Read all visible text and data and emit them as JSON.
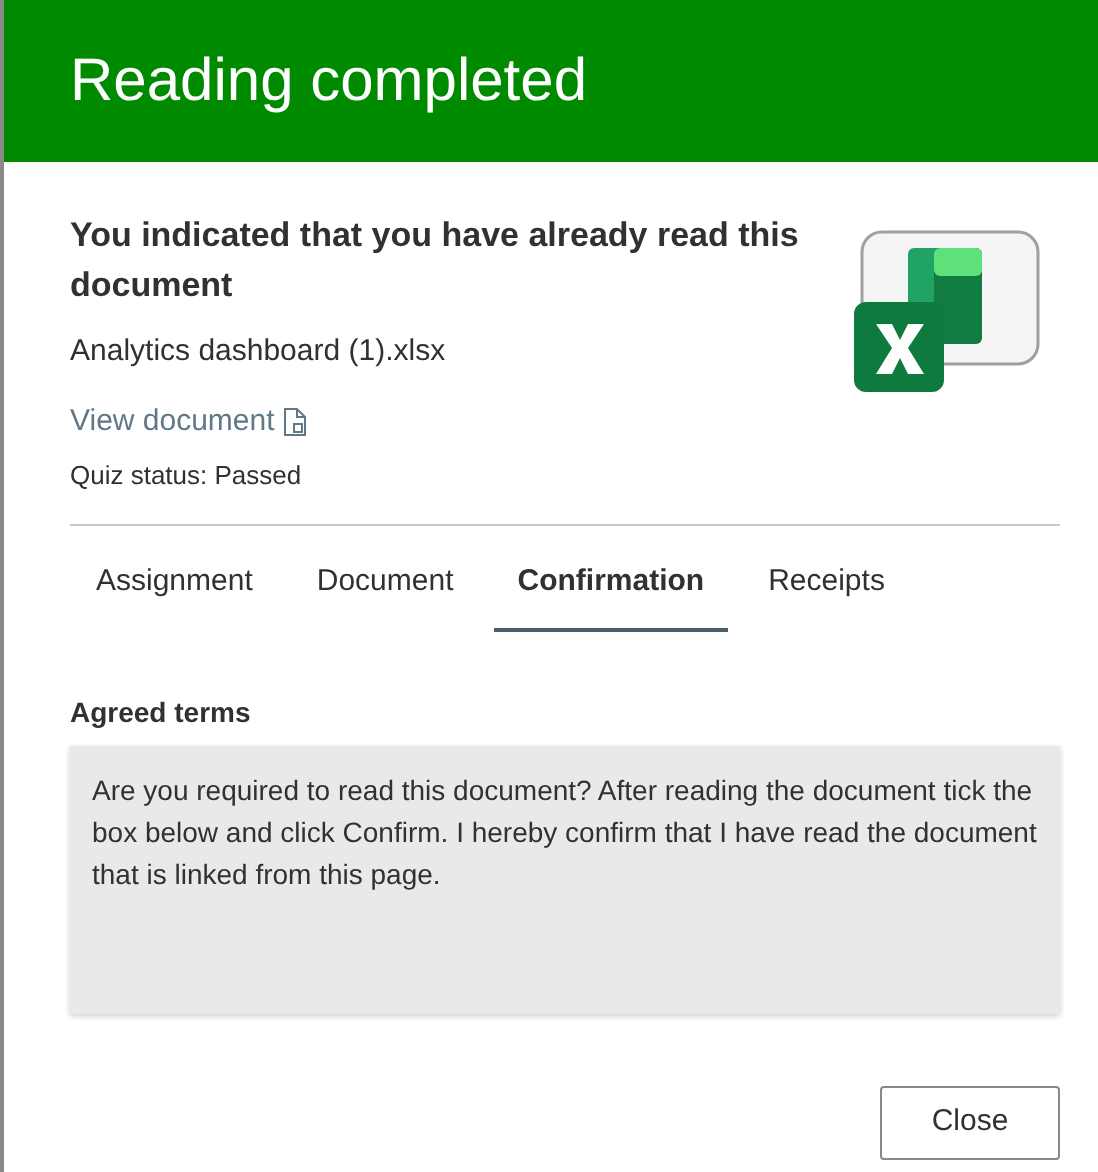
{
  "header": {
    "title": "Reading completed"
  },
  "document": {
    "heading": "You indicated that you have already read this document",
    "file_name": "Analytics dashboard (1).xlsx",
    "view_link": "View document",
    "quiz_status": "Quiz status: Passed"
  },
  "tabs": [
    {
      "label": "Assignment",
      "selected": false
    },
    {
      "label": "Document",
      "selected": false
    },
    {
      "label": "Confirmation",
      "selected": true
    },
    {
      "label": "Receipts",
      "selected": false
    }
  ],
  "agreed_terms": {
    "label": "Agreed terms",
    "text": "Are you required to read this document? After reading the document tick the box below and click Confirm. I hereby confirm that I have read the document that is linked from this page."
  },
  "buttons": [
    {
      "label": "Close"
    }
  ]
}
